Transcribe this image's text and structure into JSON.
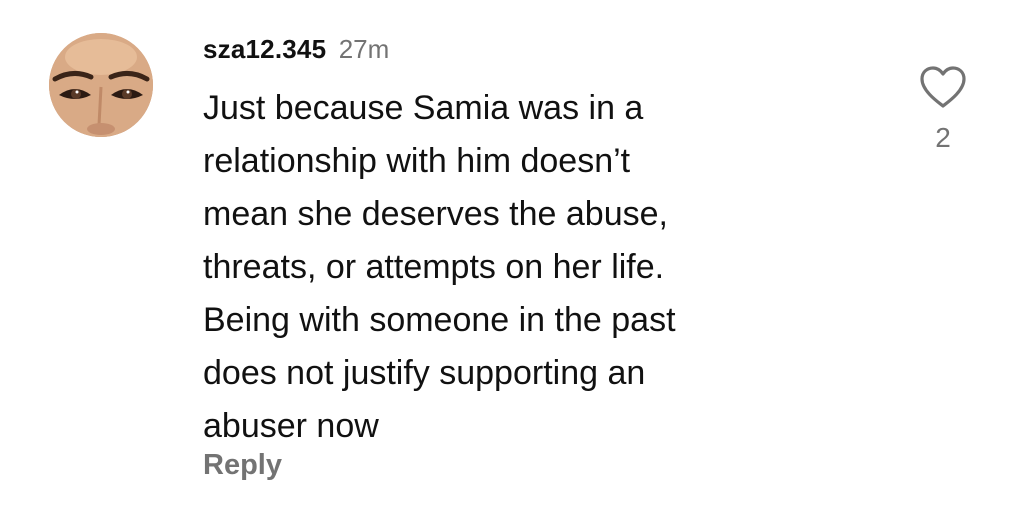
{
  "comment": {
    "username": "sza12.345",
    "timestamp": "27m",
    "body_lines": [
      "Just because Samia was in a",
      "relationship with him doesn’t",
      "mean she deserves the abuse,",
      "threats, or attempts on her life.",
      "Being with someone in the past",
      "does not justify supporting an",
      "abuser now"
    ],
    "reply_label": "Reply",
    "like_count": "2",
    "icons": {
      "like": "heart-outline-icon",
      "avatar": "user-avatar"
    }
  },
  "colors": {
    "text_primary": "#111111",
    "text_secondary": "#737373",
    "heart_stroke": "#737373",
    "background": "#ffffff"
  }
}
